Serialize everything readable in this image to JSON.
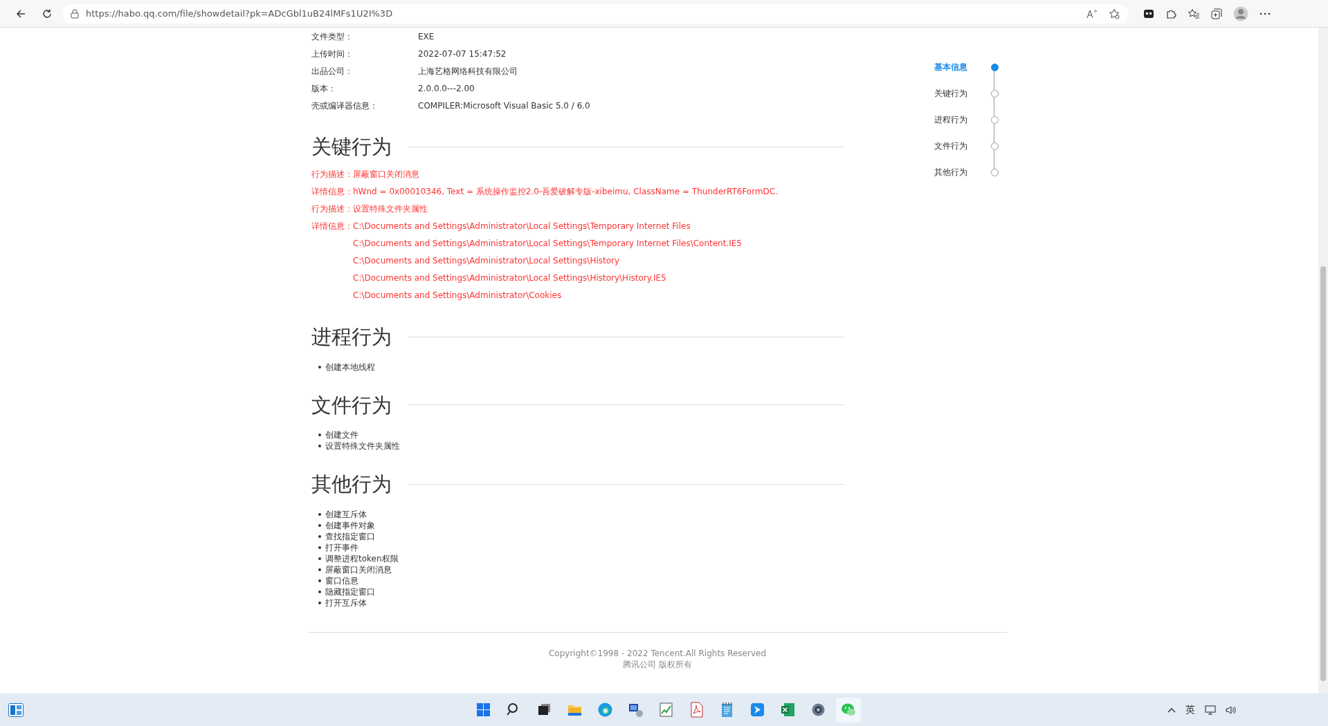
{
  "browser": {
    "url": "https://habo.qq.com/file/showdetail?pk=ADcGbl1uB24lMFs1U2I%3D"
  },
  "info_rows": [
    {
      "label": "文件类型：",
      "value": "EXE"
    },
    {
      "label": "上传时间：",
      "value": "2022-07-07 15:47:52"
    },
    {
      "label": "出品公司：",
      "value": "上海艺格网络科技有限公司"
    },
    {
      "label": "版本：",
      "value": "2.0.0.0---2.00"
    },
    {
      "label": "壳或编译器信息：",
      "value": "COMPILER:Microsoft Visual Basic 5.0 / 6.0"
    }
  ],
  "key_behaviors": {
    "title": "关键行为",
    "rows": [
      {
        "label": "行为描述：",
        "lines": [
          "屏蔽窗口关闭消息"
        ]
      },
      {
        "label": "详情信息：",
        "lines": [
          "hWnd = 0x00010346, Text = 系统操作监控2.0-吾爱破解专版-xibeimu, ClassName = ThunderRT6FormDC."
        ]
      },
      {
        "label": "行为描述：",
        "lines": [
          "设置特殊文件夹属性"
        ]
      },
      {
        "label": "详情信息：",
        "lines": [
          "C:\\Documents and Settings\\Administrator\\Local Settings\\Temporary Internet Files",
          "C:\\Documents and Settings\\Administrator\\Local Settings\\Temporary Internet Files\\Content.IE5",
          "C:\\Documents and Settings\\Administrator\\Local Settings\\History",
          "C:\\Documents and Settings\\Administrator\\Local Settings\\History\\History.IE5",
          "C:\\Documents and Settings\\Administrator\\Cookies"
        ]
      }
    ]
  },
  "list_sections": [
    {
      "title": "进程行为",
      "items": [
        "创建本地线程"
      ]
    },
    {
      "title": "文件行为",
      "items": [
        "创建文件",
        "设置特殊文件夹属性"
      ]
    },
    {
      "title": "其他行为",
      "items": [
        "创建互斥体",
        "创建事件对象",
        "查找指定窗口",
        "打开事件",
        "调整进程token权限",
        "屏蔽窗口关闭消息",
        "窗口信息",
        "隐藏指定窗口",
        "打开互斥体"
      ]
    }
  ],
  "nav": [
    {
      "label": "基本信息",
      "selected": true
    },
    {
      "label": "关键行为",
      "selected": false
    },
    {
      "label": "进程行为",
      "selected": false
    },
    {
      "label": "文件行为",
      "selected": false
    },
    {
      "label": "其他行为",
      "selected": false
    }
  ],
  "footer": {
    "copyright": "Copyright©1998 - 2022 Tencent.All Rights Reserved",
    "rights": "腾讯公司 版权所有"
  },
  "taskbar": {
    "input_language": "英"
  }
}
